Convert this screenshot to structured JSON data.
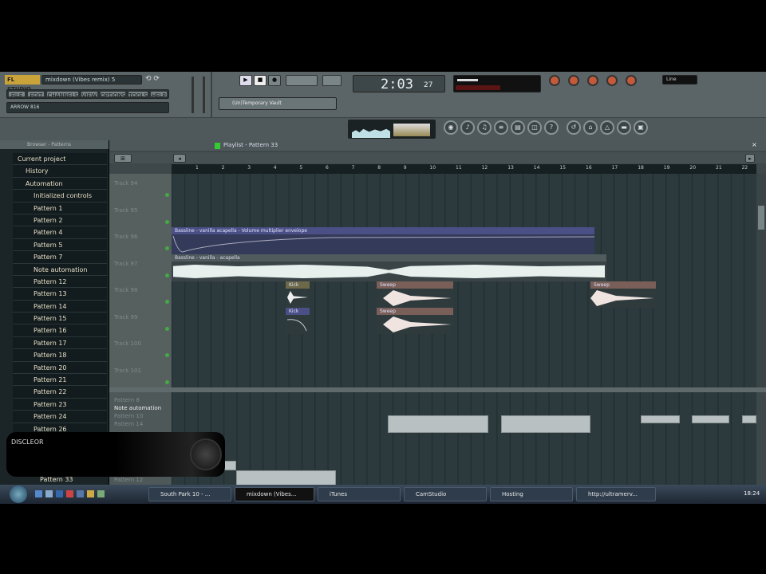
{
  "toolbar": {
    "logo": "FL STUDIO",
    "project_title": "mixdown (Vibes remix) 5",
    "menu": [
      "FILE",
      "EDIT",
      "CHANNELS",
      "VIEW",
      "OPTIONS",
      "TOOLS",
      "HELP"
    ],
    "hint_text": "ARROW 816",
    "preset_field": "(Un)Temporary Vault",
    "time_display": "2:03",
    "time_sub": "27",
    "cpu_label": "Line"
  },
  "browser": {
    "header": "Browser - Patterns",
    "items": [
      {
        "label": "Current project",
        "level": 0
      },
      {
        "label": "History",
        "level": 1
      },
      {
        "label": "Automation",
        "level": 1
      },
      {
        "label": "Initialized controls",
        "level": 2
      },
      {
        "label": "Pattern 1",
        "level": 2
      },
      {
        "label": "Pattern 2",
        "level": 2
      },
      {
        "label": "Pattern 4",
        "level": 2
      },
      {
        "label": "Pattern 5",
        "level": 2
      },
      {
        "label": "Pattern 7",
        "level": 2
      },
      {
        "label": "Note automation",
        "level": 2
      },
      {
        "label": "Pattern 12",
        "level": 2
      },
      {
        "label": "Pattern 13",
        "level": 2
      },
      {
        "label": "Pattern 14",
        "level": 2
      },
      {
        "label": "Pattern 15",
        "level": 2
      },
      {
        "label": "Pattern 16",
        "level": 2
      },
      {
        "label": "Pattern 17",
        "level": 2
      },
      {
        "label": "Pattern 18",
        "level": 2
      },
      {
        "label": "Pattern 20",
        "level": 2
      },
      {
        "label": "Pattern 21",
        "level": 2
      },
      {
        "label": "Pattern 22",
        "level": 2
      },
      {
        "label": "Pattern 23",
        "level": 2
      },
      {
        "label": "Pattern 24",
        "level": 2
      },
      {
        "label": "Pattern 26",
        "level": 2
      }
    ],
    "bottom_item": "Pattern 33"
  },
  "playlist": {
    "title": "Playlist - Pattern 33",
    "ruler": [
      "1",
      "2",
      "3",
      "4",
      "5",
      "6",
      "7",
      "8",
      "9",
      "10",
      "11",
      "12",
      "13",
      "14",
      "15",
      "16",
      "17",
      "18",
      "19",
      "20",
      "21",
      "22"
    ],
    "tracks": [
      "Track 94",
      "Track 95",
      "Track 96",
      "Track 97",
      "Track 98",
      "Track 99",
      "Track 100",
      "Track 101"
    ],
    "clips": {
      "automation": "Bassline - vanilla acapella - Volume multiplier envelope",
      "audio": "Bassline - vanilla - acapella",
      "kick": "Kick",
      "kick2": "Kick",
      "sweep1": "Sweep",
      "sweep2": "Sweep",
      "sweep3": "Sweep"
    },
    "pattern_labels": [
      "Pattern 8",
      "Note automation",
      "Pattern 10",
      "Pattern 14"
    ],
    "pattern_bottom": "Pattern 12"
  },
  "overlay": {
    "text": "DISCLEOR"
  },
  "taskbar": {
    "tasks": [
      "South Park 10 - ...",
      "mixdown (Vibes...",
      "iTunes",
      "CamStudio",
      "Hosting",
      "http://ultramerv..."
    ],
    "clock": "18:24"
  }
}
